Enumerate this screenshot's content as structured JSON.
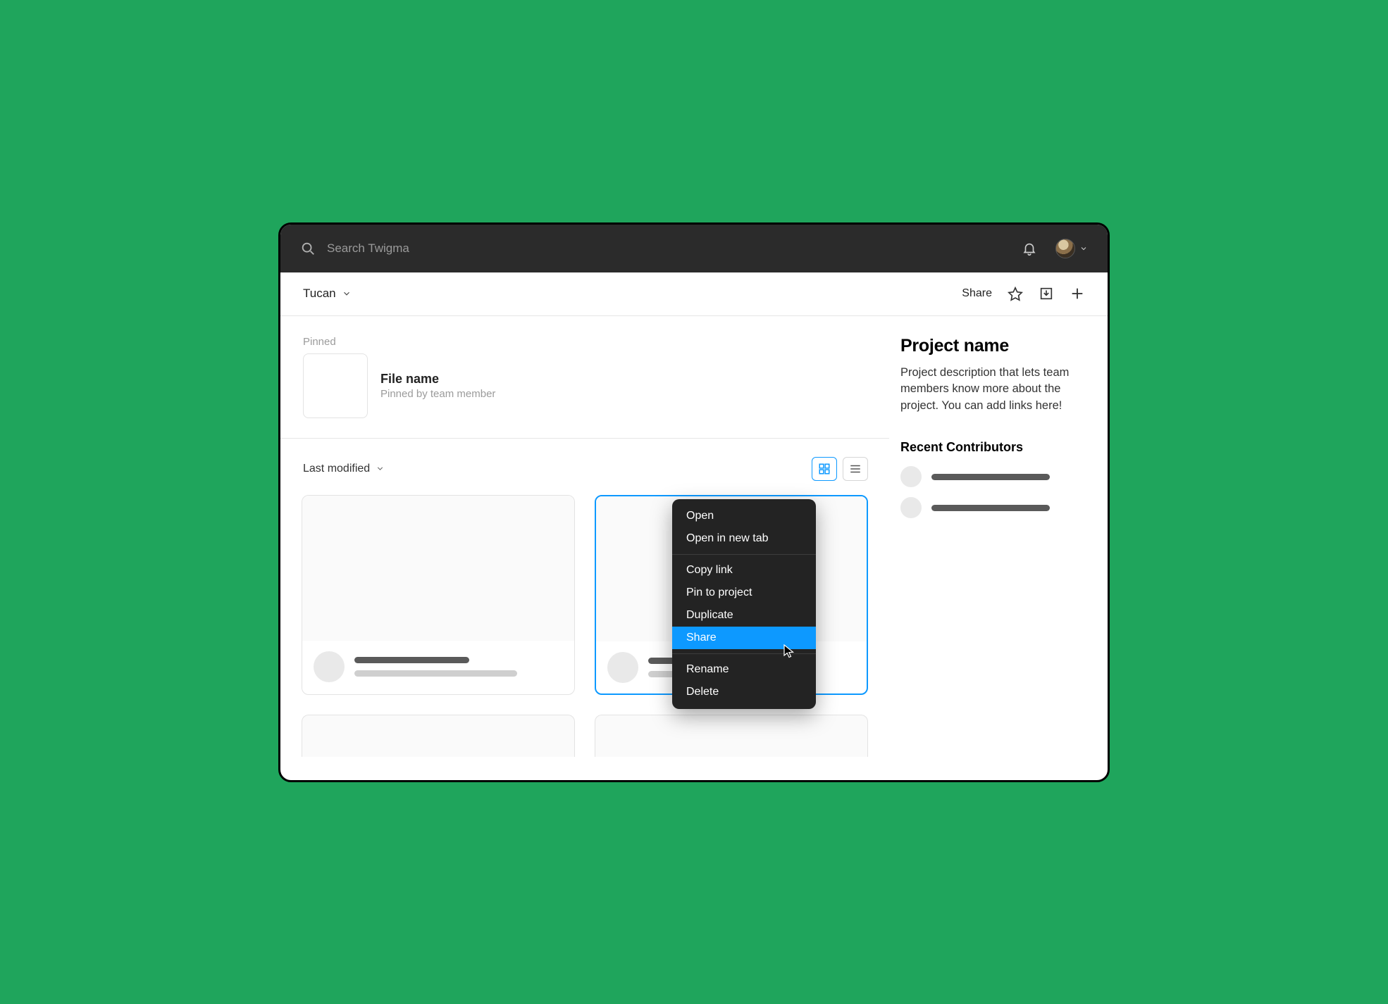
{
  "search": {
    "placeholder": "Search Twigma"
  },
  "workspace": {
    "name": "Tucan"
  },
  "subheader": {
    "share": "Share"
  },
  "pinned": {
    "label": "Pinned",
    "file_name": "File name",
    "pinned_by": "Pinned by team member"
  },
  "sort": {
    "label": "Last modified"
  },
  "project": {
    "title": "Project name",
    "description": "Project description that lets team members know more about the project. You can add links here!",
    "recent_title": "Recent Contributors"
  },
  "context_menu": {
    "open": "Open",
    "open_new_tab": "Open in new tab",
    "copy_link": "Copy link",
    "pin": "Pin to project",
    "duplicate": "Duplicate",
    "share": "Share",
    "rename": "Rename",
    "delete": "Delete"
  }
}
